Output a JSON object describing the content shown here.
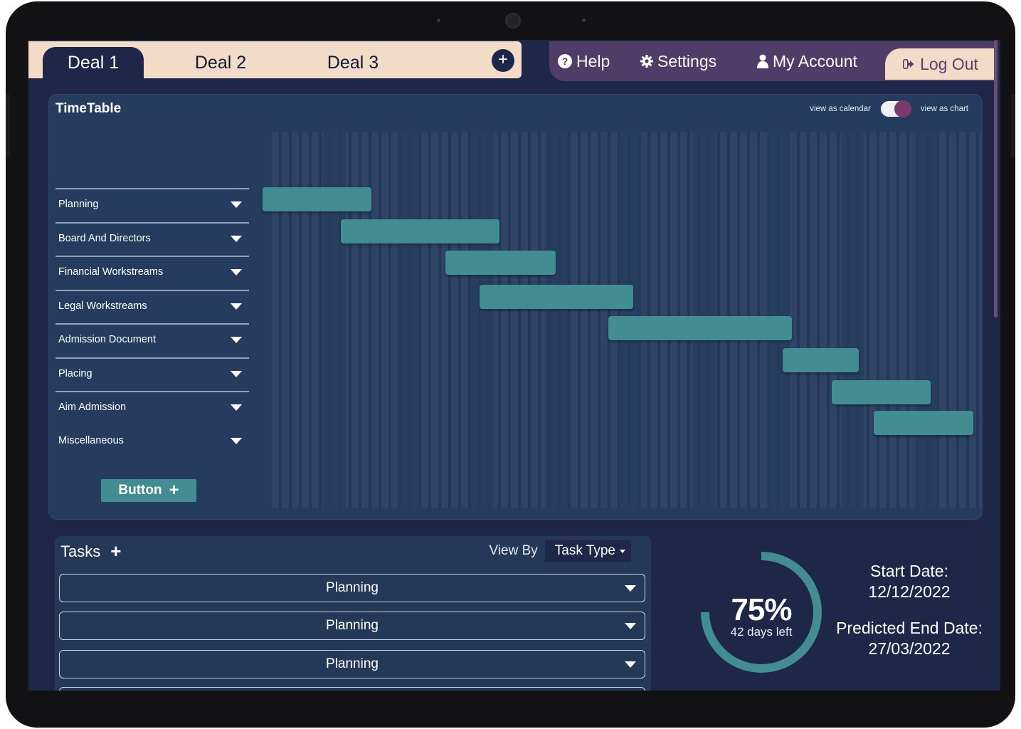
{
  "deals": {
    "tabs": [
      {
        "label": "Deal 1",
        "active": true
      },
      {
        "label": "Deal 2",
        "active": false
      },
      {
        "label": "Deal 3",
        "active": false
      }
    ],
    "add_icon": "plus-circle-icon"
  },
  "nav": {
    "help": "Help",
    "settings": "Settings",
    "account": "My Account",
    "logout": "Log Out"
  },
  "timetable": {
    "title": "TimeTable",
    "toggle_left": "view as calendar",
    "toggle_right": "view as chart",
    "rows": [
      "Planning",
      "Board And Directors",
      "Financial Workstreams",
      "Legal Workstreams",
      "Admission Document",
      "Placing",
      "Aim Admission",
      "Miscellaneous"
    ],
    "button_label": "Button"
  },
  "tasks": {
    "title": "Tasks",
    "view_by_label": "View By",
    "view_by_value": "Task Type",
    "items": [
      "Planning",
      "Planning",
      "Planning"
    ]
  },
  "progress": {
    "percent_text": "75%",
    "percent_value": 75,
    "days_left": "42 days left"
  },
  "dates": {
    "start_label": "Start Date:",
    "start_value": "12/12/2022",
    "end_label": "Predicted End Date:",
    "end_value": "27/03/2022"
  },
  "colors": {
    "background": "#1e2748",
    "accent_teal": "#428d91",
    "tab_cream": "#f2dbc7",
    "nav_purple": "#4f3d68"
  }
}
